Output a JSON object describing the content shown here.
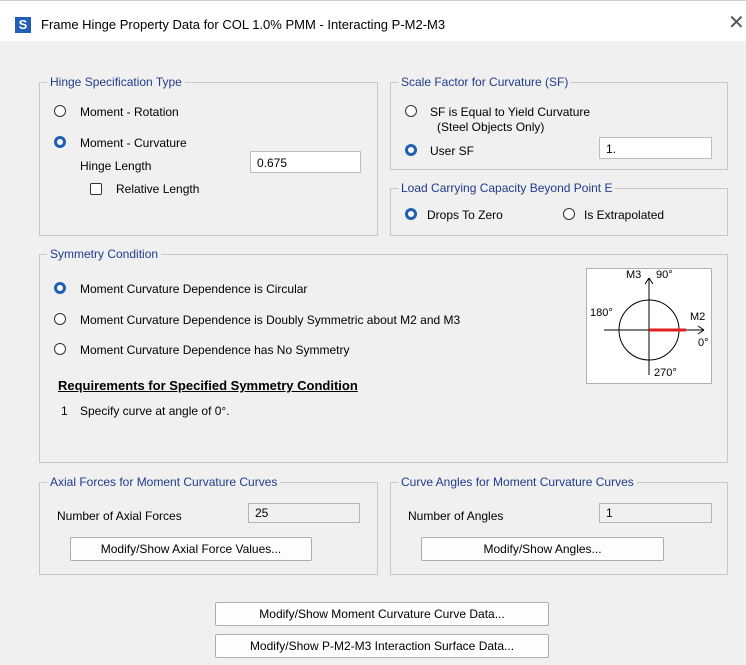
{
  "window": {
    "title": "Frame Hinge Property Data for COL 1.0% PMM - Interacting P-M2-M3",
    "app_icon_letter": "S",
    "close_glyph": "✕"
  },
  "hinge_spec": {
    "label": "Hinge Specification Type",
    "moment_rotation": "Moment - Rotation",
    "moment_curvature": "Moment - Curvature",
    "selected": "moment_curvature",
    "hinge_length_label": "Hinge Length",
    "hinge_length_value": "0.675",
    "relative_length_label": "Relative Length",
    "relative_length_checked": false
  },
  "scale_factor": {
    "label": "Scale Factor for Curvature (SF)",
    "sf_yield": "SF is Equal to Yield Curvature",
    "sf_yield_sub": "(Steel Objects Only)",
    "user_sf": "User SF",
    "user_sf_value": "1.",
    "selected": "user_sf"
  },
  "load_capacity": {
    "label": "Load Carrying Capacity Beyond Point E",
    "drops": "Drops To Zero",
    "extrapolated": "Is Extrapolated",
    "selected": "drops"
  },
  "symmetry": {
    "label": "Symmetry Condition",
    "circular": "Moment Curvature Dependence is Circular",
    "doubly": "Moment Curvature Dependence is Doubly Symmetric about M2 and M3",
    "none": "Moment Curvature Dependence has No Symmetry",
    "selected": "circular",
    "req_title": "Requirements for Specified Symmetry Condition",
    "req_num": "1",
    "req_text": "Specify curve at angle of 0°."
  },
  "diagram": {
    "m3_label": "M3",
    "deg90": "90°",
    "deg180": "180°",
    "m2_label": "M2",
    "deg0": "0°",
    "deg270": "270°",
    "highlight_color": "#e02020"
  },
  "axial": {
    "label": "Axial Forces for Moment Curvature Curves",
    "count_label": "Number of Axial Forces",
    "count_value": "25",
    "button": "Modify/Show Axial Force Values..."
  },
  "angles": {
    "label": "Curve Angles for Moment Curvature Curves",
    "count_label": "Number of Angles",
    "count_value": "1",
    "button": "Modify/Show Angles..."
  },
  "bottom_buttons": {
    "curve_data": "Modify/Show Moment Curvature Curve Data...",
    "surface_data": "Modify/Show P-M2-M3 Interaction Surface Data..."
  },
  "colors": {
    "accent": "#1f5fb5",
    "group_label": "#1f3b8c"
  }
}
